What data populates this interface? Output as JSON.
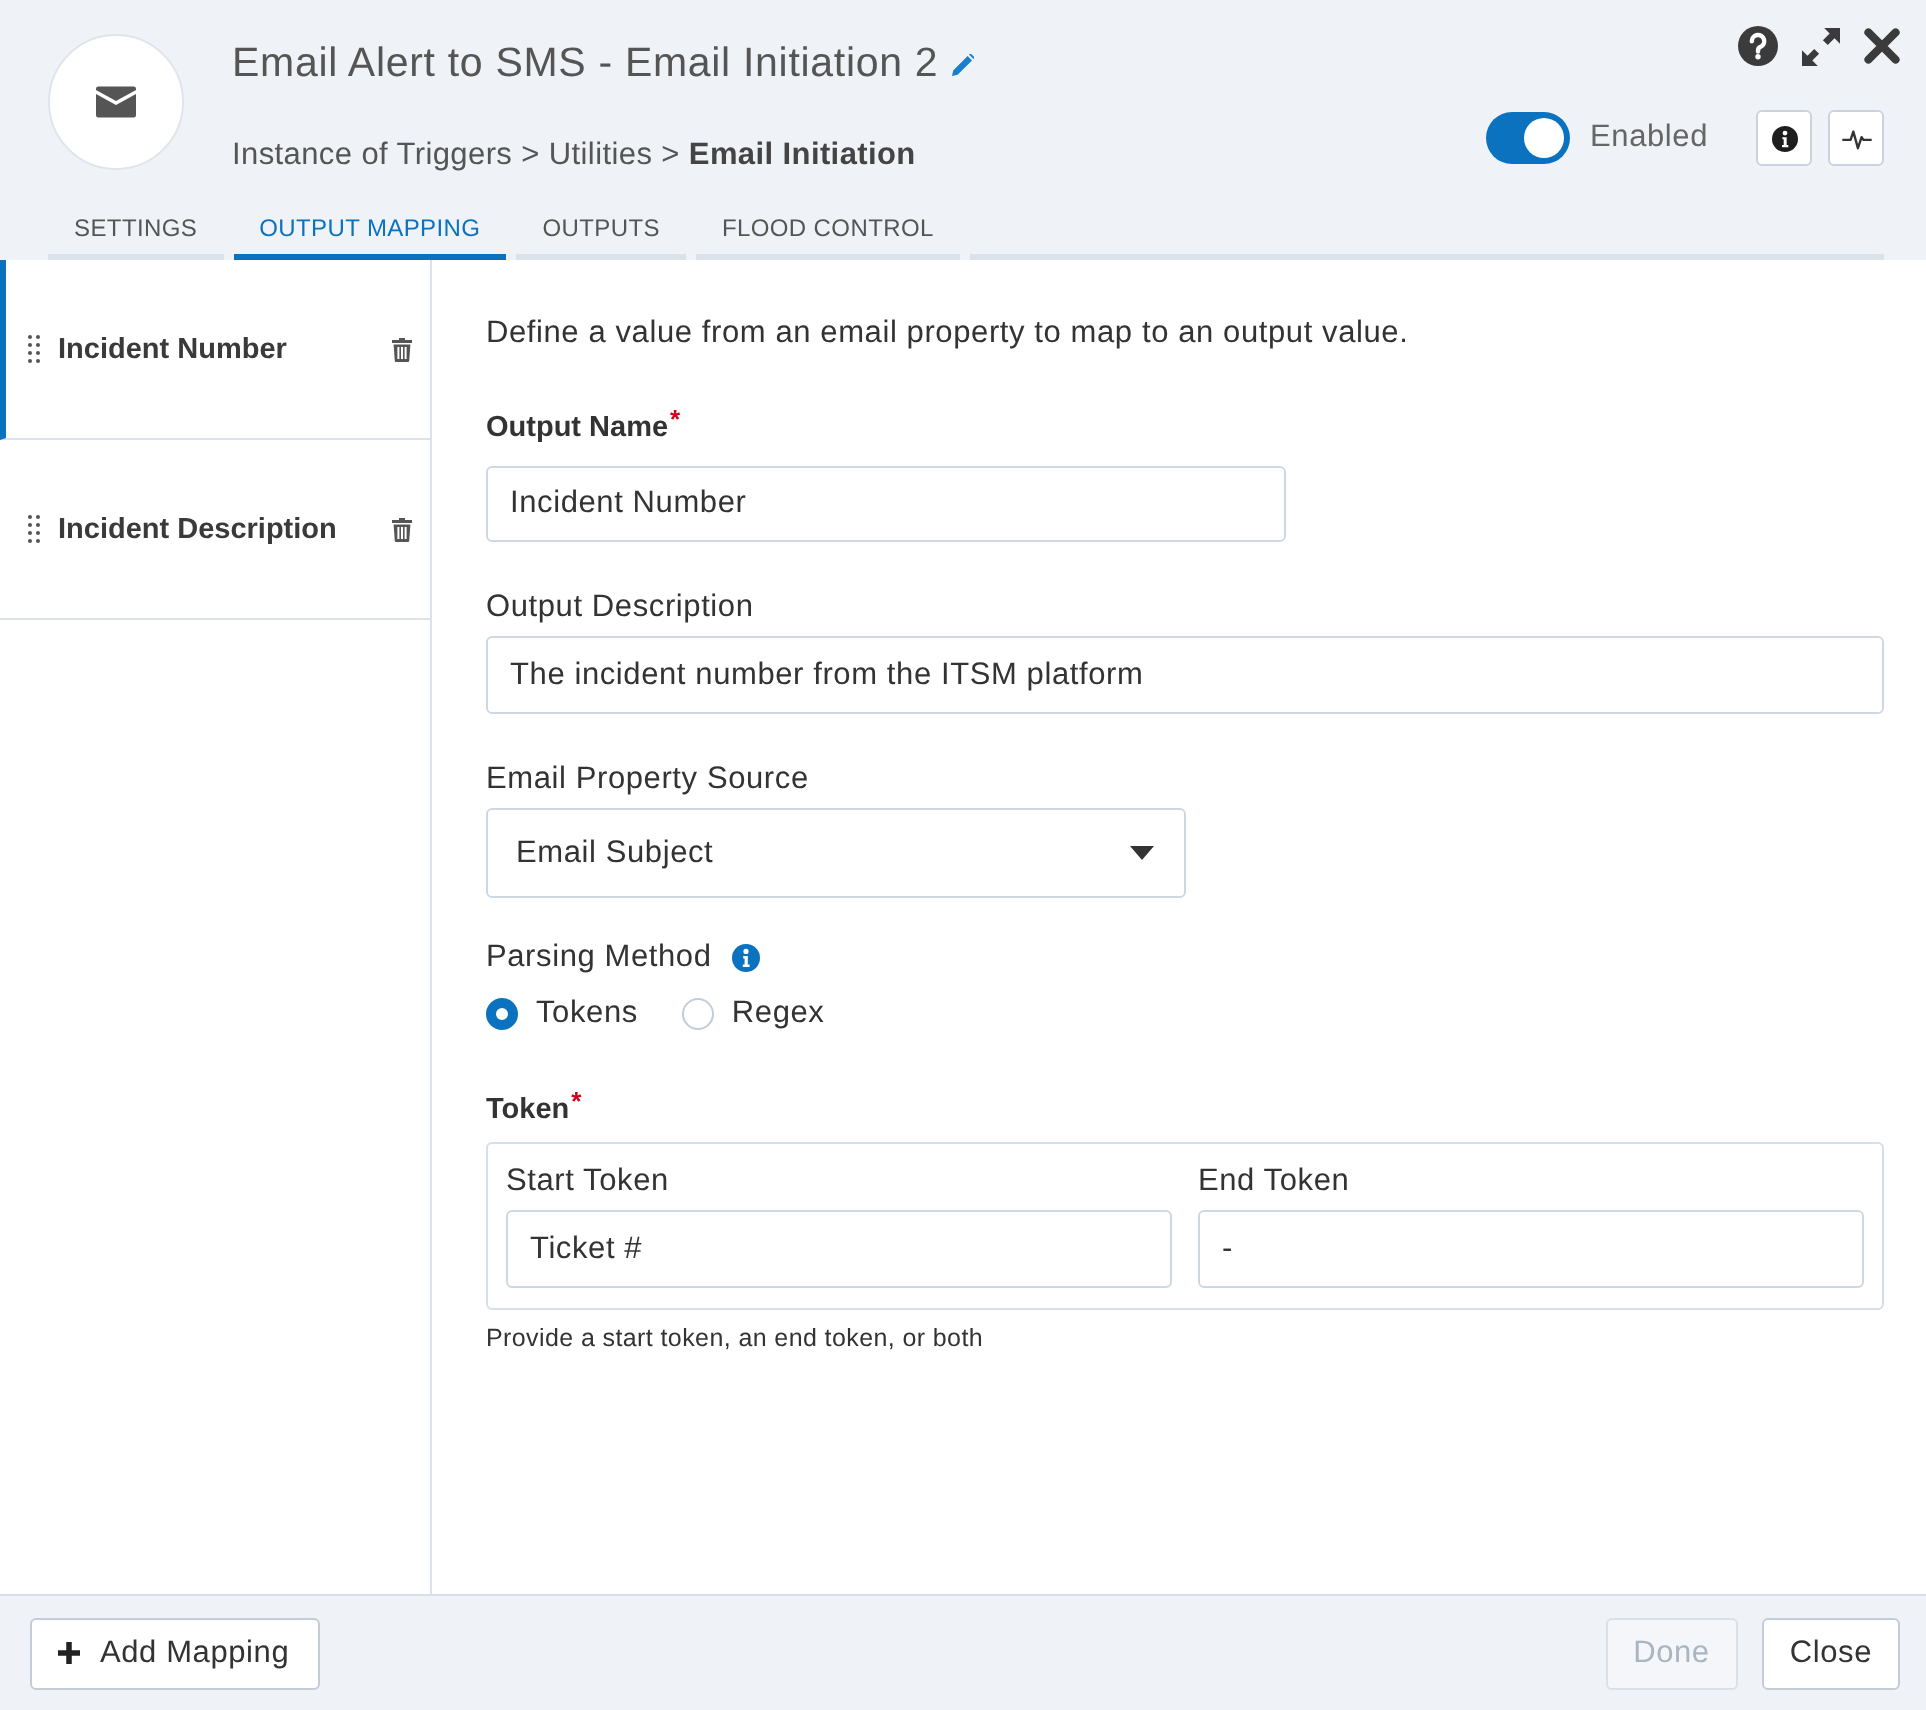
{
  "header": {
    "title": "Email Alert to SMS - Email Initiation 2",
    "breadcrumb": "Instance of Triggers > Utilities > **Email Initiation**",
    "enabled_toggle": {
      "label": "Enabled",
      "on": true
    }
  },
  "tabs": [
    {
      "label": "SETTINGS",
      "selected": false
    },
    {
      "label": "OUTPUT MAPPING",
      "selected": true
    },
    {
      "label": "OUTPUTS",
      "selected": false
    },
    {
      "label": "FLOOD CONTROL",
      "selected": false
    }
  ],
  "mappings": [
    {
      "label": "Incident Number",
      "selected": true
    },
    {
      "label": "Incident Description",
      "selected": false
    }
  ],
  "form": {
    "intro": "Define a value from an email property to map to an output value.",
    "output_name": {
      "label": "Output Name",
      "required_mark": "*",
      "value": "Incident Number"
    },
    "output_description": {
      "label": "Output Description",
      "value": "The incident number from the ITSM platform"
    },
    "email_property_source": {
      "label": "Email Property Source",
      "value": "Email Subject"
    },
    "parsing_method": {
      "label": "Parsing Method",
      "options": [
        {
          "label": "Tokens",
          "selected": true
        },
        {
          "label": "Regex",
          "selected": false
        }
      ]
    },
    "token": {
      "label": "Token",
      "required_mark": "*",
      "start": {
        "label": "Start Token",
        "value": "Ticket #"
      },
      "end": {
        "label": "End Token",
        "value": "-"
      },
      "hint": "Provide a start token, an end token, or both"
    }
  },
  "footer": {
    "add_mapping": "Add Mapping",
    "buttons": [
      {
        "label": "Done",
        "disabled": true
      },
      {
        "label": "Close",
        "disabled": false
      }
    ]
  }
}
